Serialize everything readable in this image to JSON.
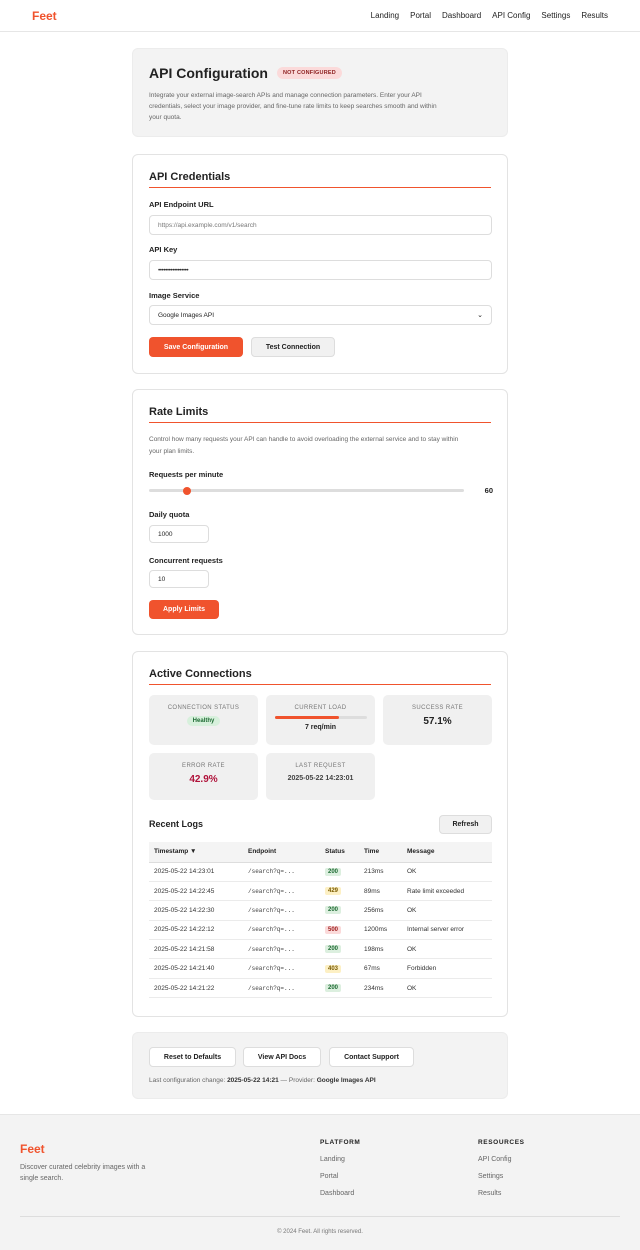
{
  "nav": {
    "brand": "Feet",
    "links": [
      "Landing",
      "Portal",
      "Dashboard",
      "API Config",
      "Settings",
      "Results"
    ]
  },
  "hero": {
    "title": "API Configuration",
    "badge": "NOT CONFIGURED",
    "description_lines": [
      "Integrate your external image-search APIs and manage connection parameters. Enter your API",
      "credentials, select your image provider, and fine-tune rate limits to keep searches smooth and within",
      "your quota."
    ]
  },
  "credentials": {
    "title": "API Credentials",
    "endpoint_label": "API Endpoint URL",
    "endpoint_placeholder": "https://api.example.com/v1/search",
    "key_label": "API Key",
    "key_value": "•••••••••••••••••",
    "service_label": "Image Service",
    "service_selected": "Google Images API",
    "save_label": "Save Configuration",
    "test_label": "Test Connection"
  },
  "rate": {
    "title": "Rate Limits",
    "description_lines": [
      "Control how many requests your API can handle to avoid overloading the external service and to stay within",
      "your plan limits."
    ],
    "rpm_label": "Requests per minute",
    "rpm_value": "60",
    "rpm_fraction": 0.12,
    "daily_label": "Daily quota",
    "daily_value": "1000",
    "concurrent_label": "Concurrent requests",
    "concurrent_value": "10",
    "apply_label": "Apply Limits"
  },
  "active": {
    "title": "Active Connections",
    "status_caption": "CONNECTION STATUS",
    "status_value": "Healthy",
    "load_caption": "CURRENT LOAD",
    "load_value": "7 req/min",
    "load_fraction": 0.7,
    "success_caption": "SUCCESS RATE",
    "success_value": "57.1%",
    "error_caption": "ERROR RATE",
    "error_value": "42.9%",
    "last_caption": "LAST REQUEST",
    "last_value": "2025-05-22 14:23:01",
    "logs_title": "Recent Logs",
    "refresh_label": "Refresh",
    "columns": [
      "Timestamp ▼",
      "Endpoint",
      "Status",
      "Time",
      "Message"
    ],
    "rows": [
      {
        "ts": "2025-05-22 14:23:01",
        "ep": "/search?q=...",
        "status": "200",
        "time": "213ms",
        "msg": "OK"
      },
      {
        "ts": "2025-05-22 14:22:45",
        "ep": "/search?q=...",
        "status": "429",
        "time": "89ms",
        "msg": "Rate limit exceeded"
      },
      {
        "ts": "2025-05-22 14:22:30",
        "ep": "/search?q=...",
        "status": "200",
        "time": "256ms",
        "msg": "OK"
      },
      {
        "ts": "2025-05-22 14:22:12",
        "ep": "/search?q=...",
        "status": "500",
        "time": "1200ms",
        "msg": "Internal server error"
      },
      {
        "ts": "2025-05-22 14:21:58",
        "ep": "/search?q=...",
        "status": "200",
        "time": "198ms",
        "msg": "OK"
      },
      {
        "ts": "2025-05-22 14:21:40",
        "ep": "/search?q=...",
        "status": "403",
        "time": "67ms",
        "msg": "Forbidden"
      },
      {
        "ts": "2025-05-22 14:21:22",
        "ep": "/search?q=...",
        "status": "200",
        "time": "234ms",
        "msg": "OK"
      }
    ]
  },
  "actions": {
    "reset_label": "Reset to Defaults",
    "docs_label": "View API Docs",
    "support_label": "Contact Support",
    "meta_prefix": "Last configuration change: ",
    "meta_date": "2025-05-22 14:21",
    "meta_mid": " — Provider: ",
    "meta_provider": "Google Images API"
  },
  "footer": {
    "brand": "Feet",
    "tagline_lines": [
      "Discover curated celebrity images with a",
      "single search."
    ],
    "platform_title": "PLATFORM",
    "platform_links": [
      "Landing",
      "Portal",
      "Dashboard"
    ],
    "resources_title": "RESOURCES",
    "resources_links": [
      "API Config",
      "Settings",
      "Results"
    ],
    "copyright": "© 2024 Feet. All rights reserved."
  },
  "colors": {
    "accent": "#f0532d",
    "success": "#1e6b33",
    "error": "#b0123a"
  }
}
